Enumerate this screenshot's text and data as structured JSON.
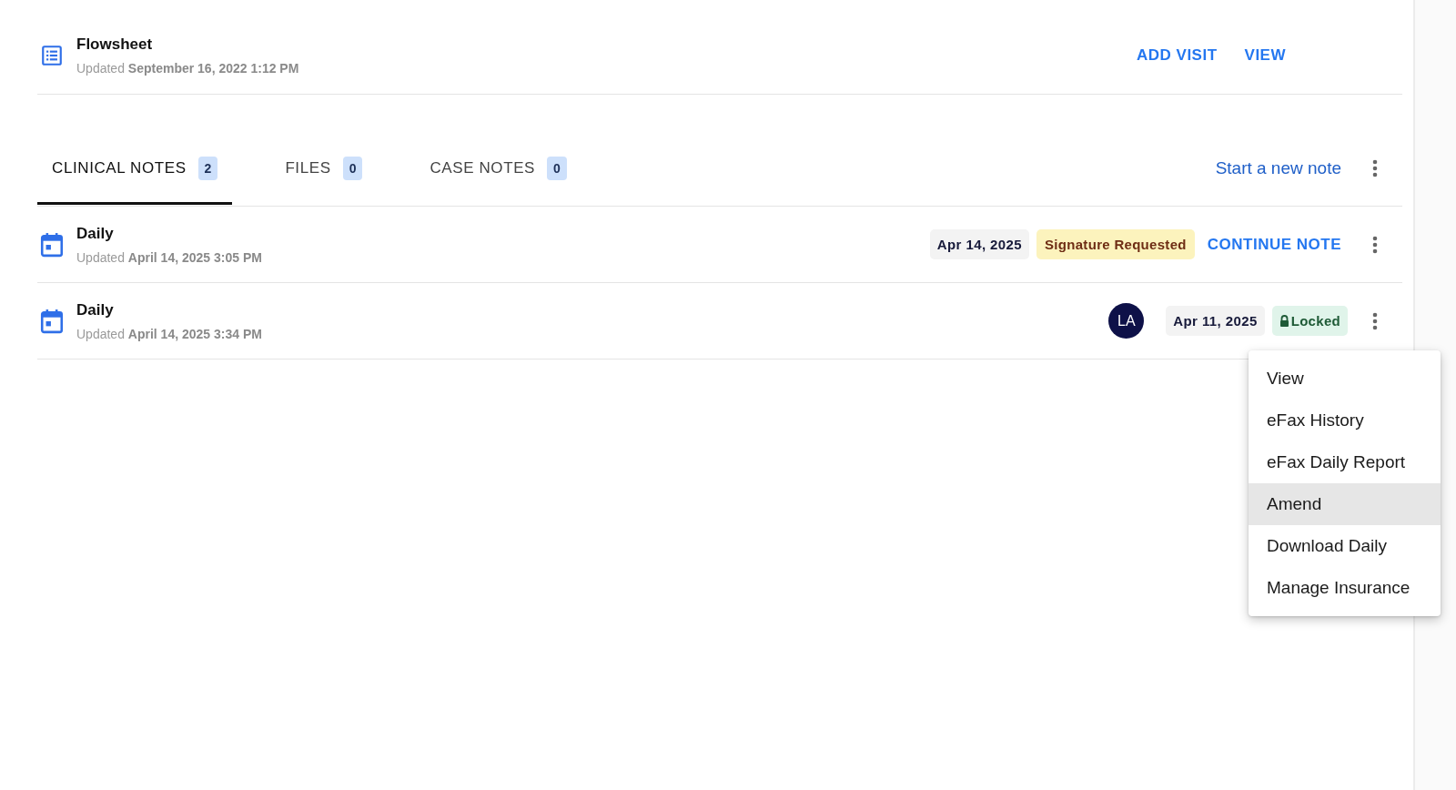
{
  "flowsheet": {
    "title": "Flowsheet",
    "updated": "Updated **September 16, 2022 1:12 PM**",
    "actions": [
      "ADD VISIT",
      "VIEW"
    ]
  },
  "tabs": [
    {
      "label": "CLINICAL NOTES",
      "count": "2",
      "selected": true
    },
    {
      "label": "FILES",
      "count": "0",
      "selected": false
    },
    {
      "label": "CASE NOTES",
      "count": "0",
      "selected": false
    }
  ],
  "new_note_link": "Start a new note",
  "notes": [
    {
      "title": "Daily",
      "updated": "Updated **April 14, 2025 3:05 PM**",
      "date": "Apr 14, 2025",
      "status": {
        "kind": "signature_requested",
        "label": "Signature Requested"
      },
      "action": "CONTINUE NOTE"
    },
    {
      "title": "Daily",
      "updated": "Updated **April 14, 2025 3:34 PM**",
      "avatar": "LA",
      "date": "Apr 11, 2025",
      "status": {
        "kind": "locked",
        "label": "Locked"
      }
    }
  ],
  "menu": {
    "items": [
      {
        "label": "View",
        "selected": false
      },
      {
        "label": "eFax History",
        "selected": false
      },
      {
        "label": "eFax Daily Report",
        "selected": false
      },
      {
        "label": "Amend",
        "selected": true
      },
      {
        "label": "Download Daily",
        "selected": false
      },
      {
        "label": "Manage Insurance",
        "selected": false
      }
    ]
  }
}
